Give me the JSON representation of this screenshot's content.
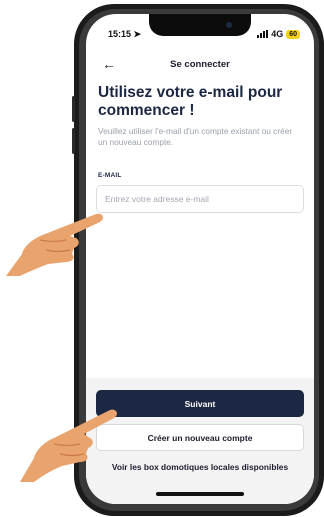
{
  "status_bar": {
    "time": "15:15",
    "network": "4G",
    "battery": "60"
  },
  "header": {
    "title": "Se connecter"
  },
  "main": {
    "heading": "Utilisez votre e-mail pour commencer !",
    "subtitle": "Veuillez utiliser l'e-mail d'un compte existant ou créer un nouveau compte.",
    "email_label": "E-MAIL",
    "email_placeholder": "Entrez votre adresse e-mail",
    "email_value": ""
  },
  "footer": {
    "next_label": "Suivant",
    "create_account_label": "Créer un nouveau compte",
    "local_boxes_label": "Voir les box domotiques locales disponibles"
  },
  "colors": {
    "primary": "#1c2743",
    "battery": "#f5d21a",
    "hand": "#e9a36c"
  },
  "icons": {
    "back": "arrow-left-icon",
    "location": "location-arrow-icon",
    "signal": "signal-bars-icon"
  }
}
